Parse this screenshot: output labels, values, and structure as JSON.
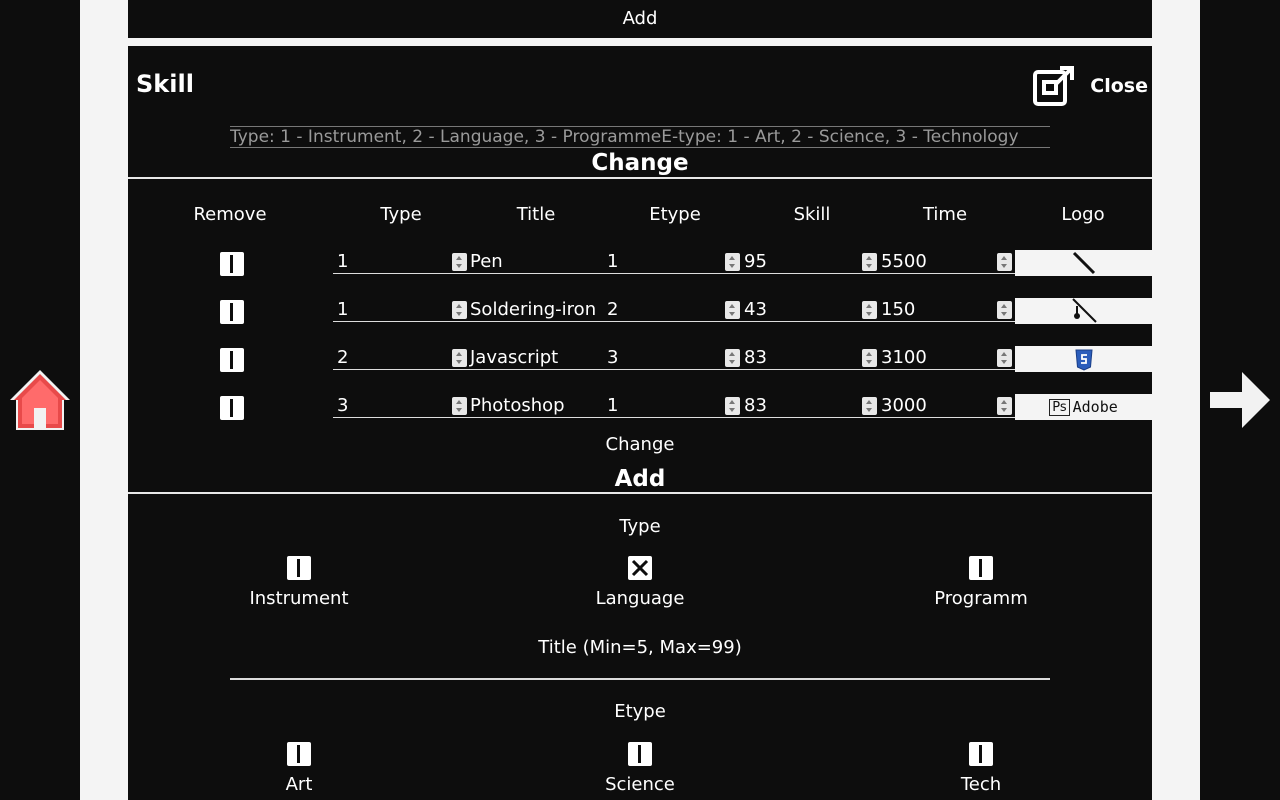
{
  "top": {
    "add_label": "Add"
  },
  "skill_panel": {
    "title": "Skill",
    "close_label": "Close",
    "hint": "Type: 1 - Instrument, 2 - Language, 3 - ProgrammeE-type: 1 - Art, 2 - Science, 3 - Technology",
    "change_heading": "Change",
    "columns": [
      "Remove",
      "Type",
      "Title",
      "Etype",
      "Skill",
      "Time",
      "Logo"
    ],
    "rows": [
      {
        "type": "1",
        "title": "Pen",
        "etype": "1",
        "skill": "95",
        "time": "5500",
        "logo": "pen-logo"
      },
      {
        "type": "1",
        "title": "Soldering-iron",
        "etype": "2",
        "skill": "43",
        "time": "150",
        "logo": "soldering-iron-logo"
      },
      {
        "type": "2",
        "title": "Javascript",
        "etype": "3",
        "skill": "83",
        "time": "3100",
        "logo": "javascript-shield-logo"
      },
      {
        "type": "3",
        "title": "Photoshop",
        "etype": "1",
        "skill": "83",
        "time": "3000",
        "logo": "photoshop-adobe-logo",
        "logo_text_ps": "Ps",
        "logo_text_adobe": "Adobe"
      }
    ],
    "change_button": "Change",
    "add_heading": "Add",
    "add_form": {
      "type_label": "Type",
      "type_options": [
        {
          "label": "Instrument",
          "checked": false
        },
        {
          "label": "Language",
          "checked": true
        },
        {
          "label": "Programm",
          "checked": false
        }
      ],
      "title_label": "Title (Min=5, Max=99)",
      "etype_label": "Etype",
      "etype_options": [
        {
          "label": "Art",
          "checked": false
        },
        {
          "label": "Science",
          "checked": false
        },
        {
          "label": "Tech",
          "checked": false
        }
      ]
    }
  },
  "colors": {
    "background": "#0d0d0d",
    "band": "#f4f4f4",
    "home_roof": "#e84a4a",
    "text": "#ffffff"
  },
  "nav": {
    "home_icon": "home-icon",
    "next_icon": "arrow-right-icon"
  }
}
